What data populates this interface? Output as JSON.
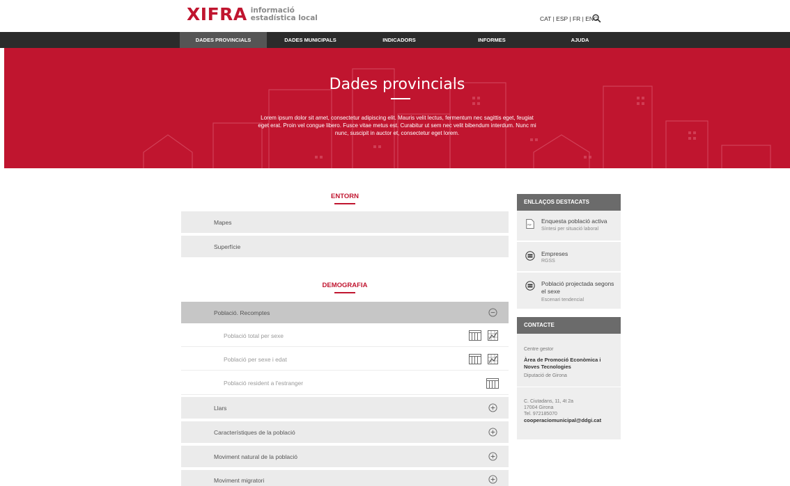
{
  "header": {
    "logo_word": "XIFRA",
    "logo_sub_1": "informació",
    "logo_sub_2": "estadística local",
    "languages": [
      "CAT",
      "ESP",
      "FR",
      "ENG"
    ],
    "search_icon": "search-icon"
  },
  "nav": {
    "items": [
      "DADES PROVINCIALS",
      "DADES MUNICIPALS",
      "INDICADORS",
      "INFORMES",
      "AJUDA"
    ],
    "active": "DADES PROVINCIALS"
  },
  "hero": {
    "title": "Dades provincials",
    "text": "Lorem ipsum dolor sit amet, consectetur adipiscing elit. Mauris velit lectus, fermentum nec sagittis eget, feugiat eget erat. Proin vel congue libero. Fusce vitae metus est. Curabitur ut sem nec velit bibendum interdum. Nunc mi nunc, suscipit in auctor et, consectetur eget lorem."
  },
  "sections": {
    "entorn": {
      "title": "ENTORN",
      "rows": [
        "Mapes",
        "Superfície"
      ]
    },
    "demografia": {
      "title": "DEMOGRAFIA",
      "open_row": "Població. Recomptes",
      "sub_rows": [
        "Població total per sexe",
        "Població per sexe i edat",
        "Població resident a l'estranger"
      ],
      "rows": [
        "Llars",
        "Característiques de la població",
        "Moviment natural de la població",
        "Moviment migratori"
      ]
    }
  },
  "sidebar": {
    "links_title": "ENLLAÇOS DESTACATS",
    "links": [
      {
        "title": "Enquesta població activa",
        "subtitle": "Síntesi per situació laboral",
        "icon": "pdf-icon"
      },
      {
        "title": "Empreses",
        "subtitle": "RGSS",
        "icon": "database-icon"
      },
      {
        "title": "Població projectada segons el sexe",
        "subtitle": "Escenari tendencial",
        "icon": "database-icon"
      }
    ],
    "contact_title": "CONTACTE",
    "contact": {
      "label": "Centre gestor",
      "org": "Àrea de Promoció Econòmica i Noves Tecnologies",
      "parent": "Diputació de Girona",
      "address_1": "C. Ciutadans, 11, 4t 2a",
      "address_2": "17004 Girona",
      "phone": "Tel. 972185070",
      "email": "cooperaciomunicipal@ddgi.cat"
    }
  },
  "colors": {
    "brand_red": "#c0152f",
    "nav_dark": "#2b2b2b",
    "row_gray": "#ebebeb",
    "sidebar_head": "#6b6b6b"
  }
}
